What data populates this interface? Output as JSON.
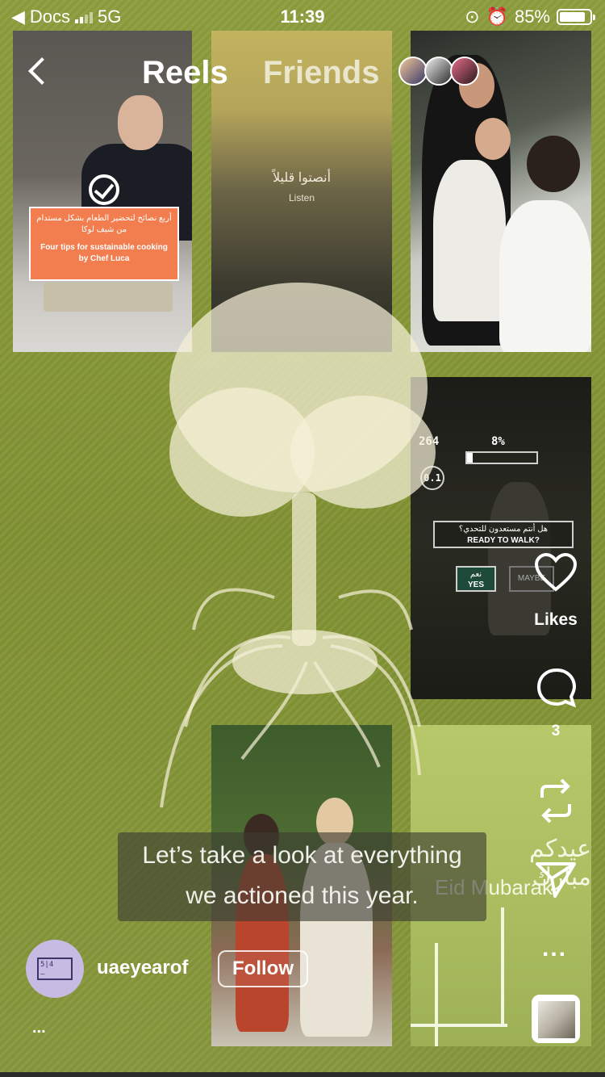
{
  "status_bar": {
    "back_app": "Docs",
    "network": "5G",
    "time": "11:39",
    "battery": "85%",
    "battery_level": 0.85
  },
  "header": {
    "tab_active": "Reels",
    "tab_inactive": "Friends"
  },
  "tiles": {
    "cooking": {
      "arabic": "أربع نصائح لتحضير الطعام بشكل مستدام من شيف لوكا",
      "english": "Four tips for sustainable cooking by Chef Luca"
    },
    "listen": {
      "arabic": "أنصتوا قليلاً",
      "english": "Listen"
    },
    "hud": {
      "top_number": "264",
      "progress": "8%",
      "gauge": "0.1",
      "question_ar": "هل أنتم مستعدون للتحدي؟",
      "question_en": "READY TO WALK?",
      "yes_ar": "نعم",
      "yes": "YES",
      "maybe": "MAYBE"
    },
    "eid": {
      "arabic": "عيدكم مبارك",
      "english": "Eid Mubarak"
    }
  },
  "subtitle": {
    "line1": "Let’s take a look at everything",
    "line2": "we actioned this year."
  },
  "actions": {
    "likes_label": "Likes",
    "comment_count": "3",
    "more": "..."
  },
  "account": {
    "username": "uaeyearof",
    "follow_label": "Follow",
    "caption_more": "..."
  },
  "icons": {
    "back": "chevron-left-icon",
    "heart": "heart-icon",
    "comment": "comment-icon",
    "repost": "repost-icon",
    "send": "send-icon"
  }
}
